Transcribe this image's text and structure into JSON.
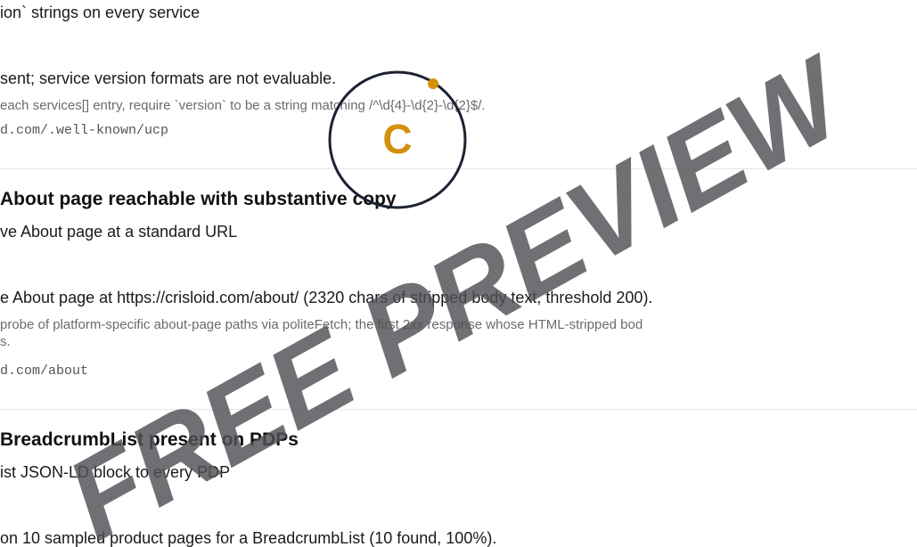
{
  "section1": {
    "recommendation": "ion` strings on every service",
    "finding": "sent; service version formats are not evaluable.",
    "method": "each services[] entry, require `version` to be a string matching /^\\d{4}-\\d{2}-\\d{2}$/.",
    "evidence": "d.com/.well-known/ucp"
  },
  "section2": {
    "title": "About page reachable with substantive copy",
    "recommendation": "ve About page at a standard URL",
    "finding": "e About page at https://crisloid.com/about/ (2320 chars of stripped body text, threshold 200).",
    "method": "probe of platform-specific about-page paths via politeFetch; the first 2xx response whose HTML-stripped bod",
    "method_cont": "s.",
    "evidence": "d.com/about"
  },
  "section3": {
    "title": "BreadcrumbList present on PDPs",
    "recommendation": "ist JSON-LD block to every PDP",
    "finding": "on 10 sampled product pages for a BreadcrumbList (10 found, 100%)."
  },
  "watermark": {
    "text": "FREE PREVIEW",
    "color": "#505056",
    "logo_letter": "C",
    "logo_color": "#d4900a"
  }
}
